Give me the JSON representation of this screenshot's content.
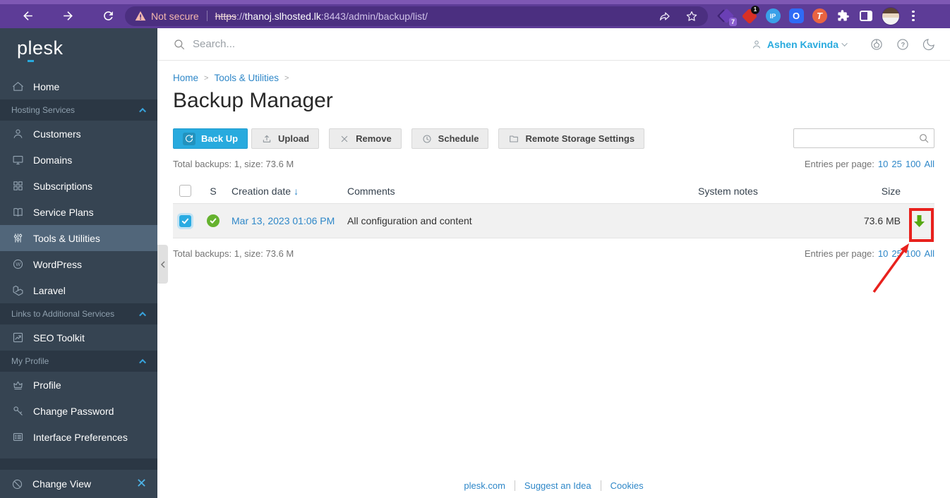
{
  "browser": {
    "not_secure_label": "Not secure",
    "url_scheme": "https",
    "url_separator": "://",
    "url_host": "thanoj.slhosted.lk",
    "url_path": ":8443/admin/backup/list/",
    "ext1_badge": "7",
    "ext2_badge": "1",
    "ext_ip_label": "IP",
    "ext_o_label": "O",
    "ext_t_label": "T"
  },
  "sidebar": {
    "logo": "plesk",
    "home": "Home",
    "section_hosting": "Hosting Services",
    "customers": "Customers",
    "domains": "Domains",
    "subscriptions": "Subscriptions",
    "service_plans": "Service Plans",
    "tools_utilities": "Tools & Utilities",
    "wordpress": "WordPress",
    "laravel": "Laravel",
    "section_links": "Links to Additional Services",
    "seo_toolkit": "SEO Toolkit",
    "section_profile": "My Profile",
    "profile": "Profile",
    "change_password": "Change Password",
    "interface_preferences": "Interface Preferences",
    "change_view": "Change View"
  },
  "topbar": {
    "search_placeholder": "Search...",
    "user_name": "Ashen Kavinda"
  },
  "breadcrumb": {
    "home": "Home",
    "tools": "Tools & Utilities"
  },
  "page": {
    "title": "Backup Manager"
  },
  "toolbar": {
    "back_up": "Back Up",
    "upload": "Upload",
    "remove": "Remove",
    "schedule": "Schedule",
    "remote_storage": "Remote Storage Settings"
  },
  "backups": {
    "total": "Total backups: 1, size: 73.6 M",
    "entries_label": "Entries per page:",
    "entries_options": {
      "o10": "10",
      "o25": "25",
      "o100": "100",
      "all": "All"
    },
    "columns": {
      "s": "S",
      "creation_date": "Creation date",
      "sort_arrow": "↓",
      "comments": "Comments",
      "system_notes": "System notes",
      "size": "Size"
    },
    "row": {
      "date": "Mar 13, 2023 01:06 PM",
      "comment": "All configuration and content",
      "size": "73.6 MB"
    }
  },
  "footer": {
    "plesk_com": "plesk.com",
    "suggest_idea": "Suggest an Idea",
    "cookies": "Cookies"
  },
  "colors": {
    "accent_blue": "#28aade",
    "link_blue": "#2e87c8",
    "status_green": "#65b22e",
    "download_green": "#56a811",
    "annotation_red": "#e8211d",
    "browser_purple": "#5d3c97",
    "sidebar_bg": "#364452"
  }
}
